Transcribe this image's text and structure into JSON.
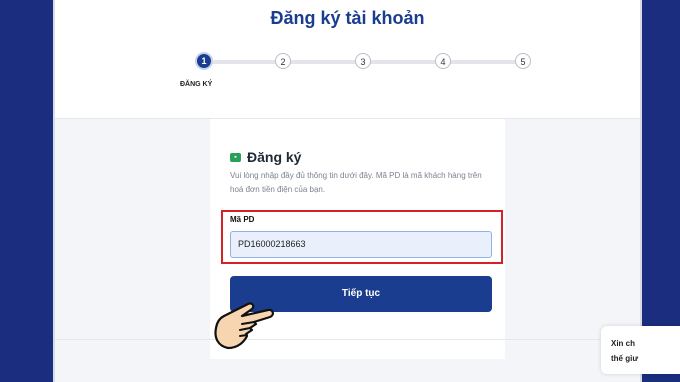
{
  "page": {
    "title": "Đăng ký tài khoản"
  },
  "stepper": {
    "steps": [
      "1",
      "2",
      "3",
      "4",
      "5"
    ],
    "active_step": 1,
    "active_label": "ĐĂNG KÝ"
  },
  "form": {
    "icon": "id-card-icon",
    "heading": "Đăng ký",
    "description": "Vui lòng nhập đầy đủ thông tin dưới đây. Mã PD là mã khách hàng trên hoá đơn tiền điện của bạn.",
    "field_label": "Mã PD",
    "field_value": "PD16000218663",
    "submit_label": "Tiếp tục"
  },
  "chat_widget": {
    "line1": "Xin ch",
    "line2": "thế giư"
  },
  "colors": {
    "brand": "#1a3d8f",
    "background": "#1a2d7f",
    "highlight": "#d42328",
    "icon": "#27a05b"
  }
}
